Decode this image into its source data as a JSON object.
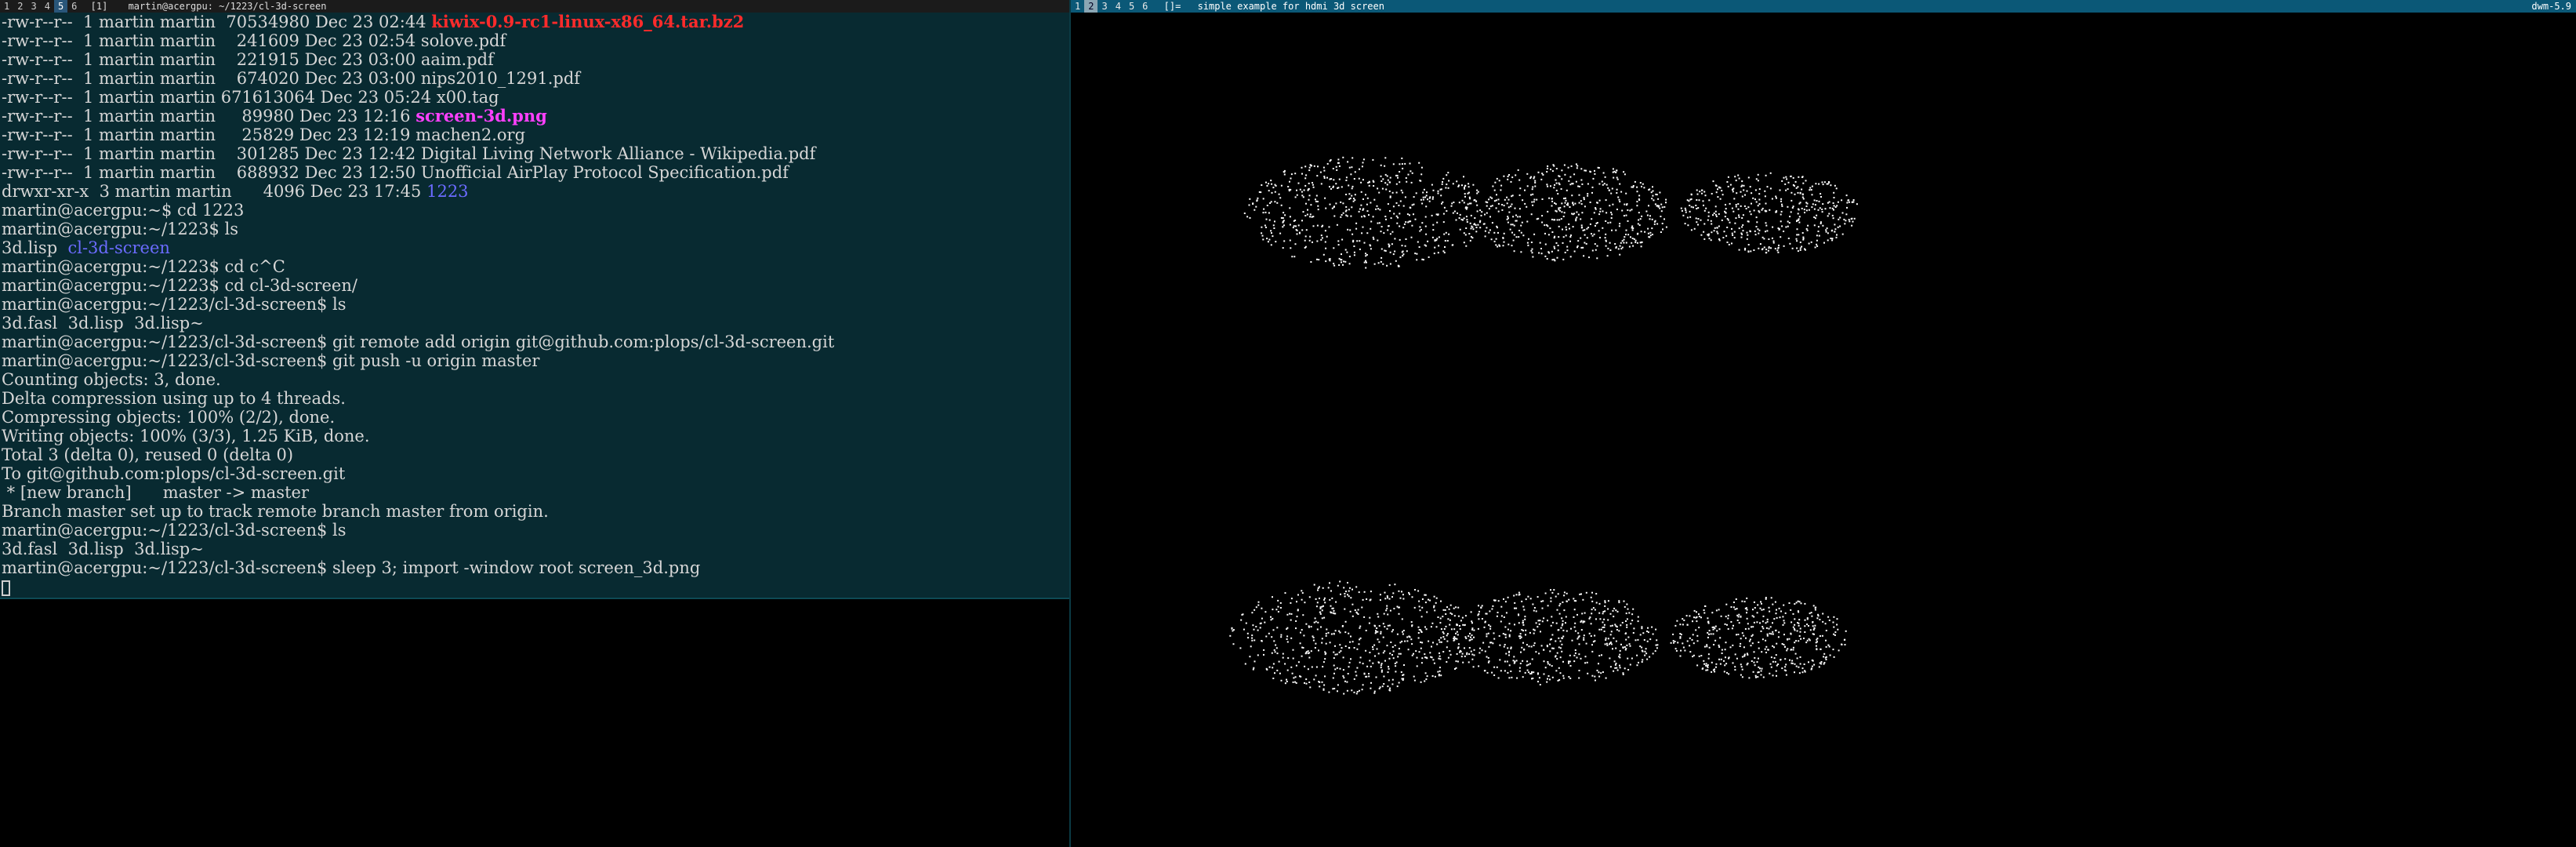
{
  "left_bar": {
    "tags": [
      {
        "label": "1",
        "selected": false
      },
      {
        "label": "2",
        "selected": false
      },
      {
        "label": "3",
        "selected": false
      },
      {
        "label": "4",
        "selected": false
      },
      {
        "label": "5",
        "selected": true
      },
      {
        "label": "6",
        "selected": false
      }
    ],
    "layout": "[1]",
    "title": "martin@acergpu: ~/1223/cl-3d-screen"
  },
  "right_bar": {
    "tags": [
      {
        "label": "1",
        "selected": false
      },
      {
        "label": "2",
        "selected": true
      },
      {
        "label": "3",
        "selected": false
      },
      {
        "label": "4",
        "selected": false
      },
      {
        "label": "5",
        "selected": false
      },
      {
        "label": "6",
        "selected": false
      }
    ],
    "layout": "[]=",
    "title": "simple example for hdmi 3d screen",
    "status": "dwm-5.9"
  },
  "terminal": {
    "lines": [
      [
        "-rw-r--r--  1 martin martin  70534980 Dec 23 02:44 ",
        {
          "t": "kiwix-0.9-rc1-linux-x86_64.tar.bz2",
          "c": "fn-red"
        }
      ],
      [
        "-rw-r--r--  1 martin martin    241609 Dec 23 02:54 solove.pdf"
      ],
      [
        "-rw-r--r--  1 martin martin    221915 Dec 23 03:00 aaim.pdf"
      ],
      [
        "-rw-r--r--  1 martin martin    674020 Dec 23 03:00 nips2010_1291.pdf"
      ],
      [
        "-rw-r--r--  1 martin martin 671613064 Dec 23 05:24 x00.tag"
      ],
      [
        "-rw-r--r--  1 martin martin     89980 Dec 23 12:16 ",
        {
          "t": "screen-3d.png",
          "c": "fn-mag"
        }
      ],
      [
        "-rw-r--r--  1 martin martin     25829 Dec 23 12:19 machen2.org"
      ],
      [
        "-rw-r--r--  1 martin martin    301285 Dec 23 12:42 Digital Living Network Alliance - Wikipedia.pdf"
      ],
      [
        "-rw-r--r--  1 martin martin    688932 Dec 23 12:50 Unofficial AirPlay Protocol Specification.pdf"
      ],
      [
        "drwxr-xr-x  3 martin martin      4096 Dec 23 17:45 ",
        {
          "t": "1223",
          "c": "fn-blue"
        }
      ],
      [
        "martin@acergpu:~$ cd 1223"
      ],
      [
        "martin@acergpu:~/1223$ ls"
      ],
      [
        "3d.lisp  ",
        {
          "t": "cl-3d-screen",
          "c": "fn-blue"
        }
      ],
      [
        "martin@acergpu:~/1223$ cd c^C"
      ],
      [
        "martin@acergpu:~/1223$ cd cl-3d-screen/"
      ],
      [
        "martin@acergpu:~/1223/cl-3d-screen$ ls"
      ],
      [
        "3d.fasl  3d.lisp  3d.lisp~"
      ],
      [
        "martin@acergpu:~/1223/cl-3d-screen$ git remote add origin git@github.com:plops/cl-3d-screen.git"
      ],
      [
        "martin@acergpu:~/1223/cl-3d-screen$ git push -u origin master"
      ],
      [
        "Counting objects: 3, done."
      ],
      [
        "Delta compression using up to 4 threads."
      ],
      [
        "Compressing objects: 100% (2/2), done."
      ],
      [
        "Writing objects: 100% (3/3), 1.25 KiB, done."
      ],
      [
        "Total 3 (delta 0), reused 0 (delta 0)"
      ],
      [
        "To git@github.com:plops/cl-3d-screen.git"
      ],
      [
        " * [new branch]      master -> master"
      ],
      [
        "Branch master set up to track remote branch master from origin."
      ],
      [
        "martin@acergpu:~/1223/cl-3d-screen$ ls"
      ],
      [
        "3d.fasl  3d.lisp  3d.lisp~"
      ],
      [
        "martin@acergpu:~/1223/cl-3d-screen$ sleep 3; import -window root screen_3d.png"
      ]
    ]
  },
  "colors": {
    "terminal_bg": "#082a31",
    "dwm_bar_active": "#0b5877",
    "filename_archive": "#ff2b2b",
    "filename_image": "#ff40ff",
    "directory": "#6b6bff"
  }
}
